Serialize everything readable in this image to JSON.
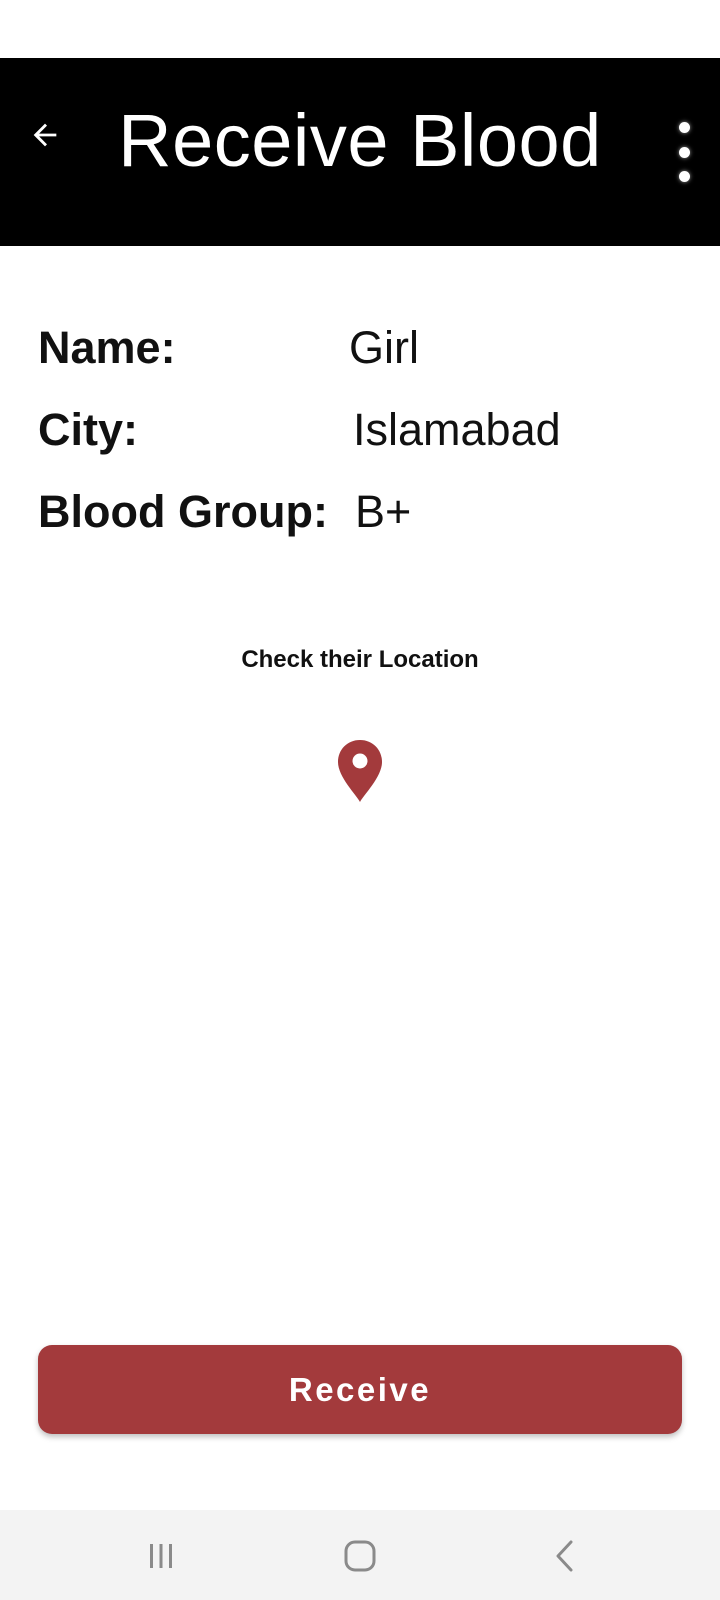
{
  "app_bar": {
    "title": "Receive Blood",
    "back_icon": "arrow-left-icon",
    "menu_icon": "more-vertical-icon",
    "background": "#000000"
  },
  "details": [
    {
      "label": "Name:",
      "value": "Girl"
    },
    {
      "label": "City:",
      "value": "Islamabad"
    },
    {
      "label": "Blood Group:",
      "value": "B+"
    }
  ],
  "location": {
    "caption": "Check their Location",
    "icon": "map-pin-icon",
    "color": "#a33a3c"
  },
  "actions": {
    "receive_label": "Receive",
    "receive_color": "#a33a3c"
  },
  "system_nav": {
    "recents_icon": "recents-icon",
    "home_icon": "home-icon",
    "back_icon": "back-chevron-icon"
  }
}
